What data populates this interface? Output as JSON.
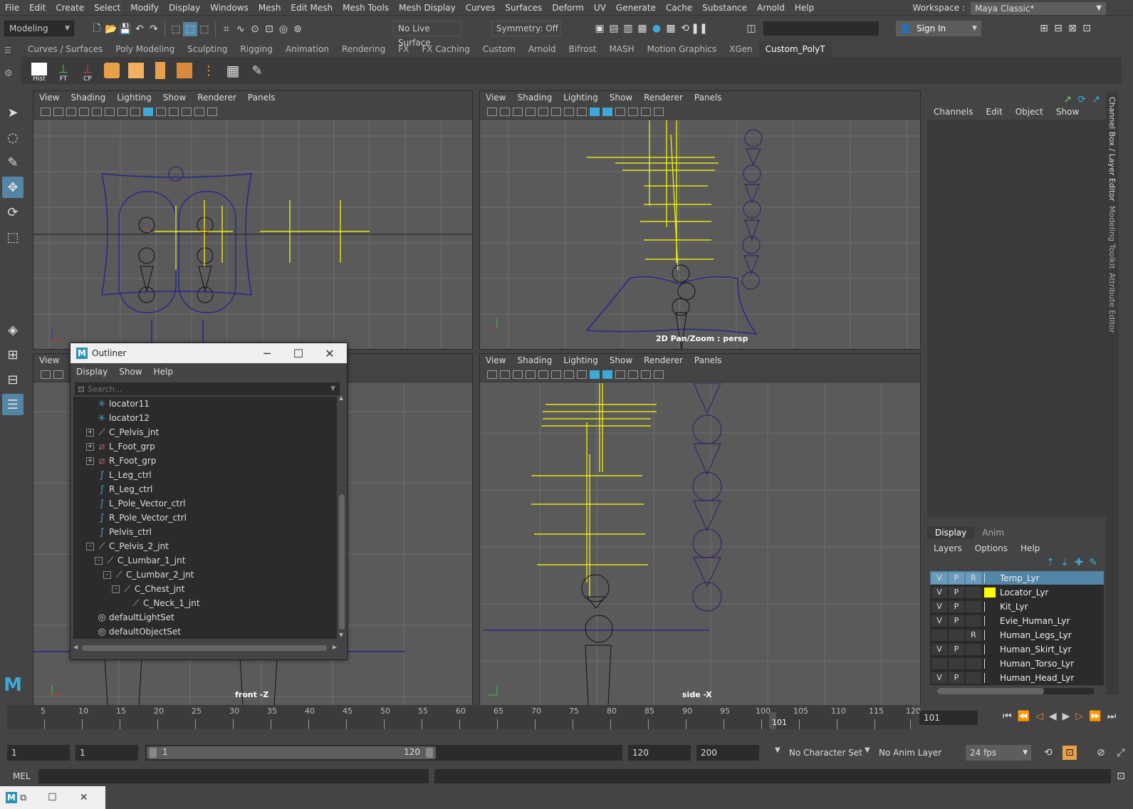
{
  "menubar": {
    "items": [
      "File",
      "Edit",
      "Create",
      "Select",
      "Modify",
      "Display",
      "Windows",
      "Mesh",
      "Edit Mesh",
      "Mesh Tools",
      "Mesh Display",
      "Curves",
      "Surfaces",
      "Deform",
      "UV",
      "Generate",
      "Cache",
      "Substance",
      "Arnold",
      "Help"
    ],
    "workspace_label": "Workspace :",
    "workspace_value": "Maya Classic*"
  },
  "statusline": {
    "mode": "Modeling",
    "live_surface": "No Live Surface",
    "symmetry": "Symmetry: Off",
    "sign_in": "Sign In"
  },
  "shelf": {
    "tabs": [
      "Curves / Surfaces",
      "Poly Modeling",
      "Sculpting",
      "Rigging",
      "Animation",
      "Rendering",
      "FX",
      "FX Caching",
      "Custom",
      "Arnold",
      "Bifrost",
      "MASH",
      "Motion Graphics",
      "XGen",
      "Custom_PolyT"
    ],
    "active_tab": "Custom_PolyT",
    "icon_labels": [
      "Hist",
      "FT",
      "CP"
    ]
  },
  "viewport_menu": [
    "View",
    "Shading",
    "Lighting",
    "Show",
    "Renderer",
    "Panels"
  ],
  "viewports": {
    "top_left_label": "",
    "top_right_label": "2D Pan/Zoom : persp",
    "bottom_left_label": "front -Z",
    "bottom_right_label": "side -X"
  },
  "channelbox": {
    "menu": [
      "Channels",
      "Edit",
      "Object",
      "Show"
    ],
    "side_tabs": [
      "Channel Box / Layer Editor",
      "Modeling Toolkit",
      "Attribute Editor"
    ]
  },
  "layers": {
    "tabs": [
      "Display",
      "Anim"
    ],
    "active_tab": "Display",
    "menu": [
      "Layers",
      "Options",
      "Help"
    ],
    "rows": [
      {
        "v": "V",
        "p": "P",
        "r": "R",
        "color": "",
        "name": "Temp_Lyr",
        "selected": true
      },
      {
        "v": "V",
        "p": "P",
        "r": "",
        "color": "#ffff00",
        "name": "Locator_Lyr",
        "selected": false
      },
      {
        "v": "V",
        "p": "P",
        "r": "",
        "color": "",
        "name": "Kit_Lyr",
        "selected": false
      },
      {
        "v": "V",
        "p": "P",
        "r": "",
        "color": "",
        "name": "Evie_Human_Lyr",
        "selected": false
      },
      {
        "v": "",
        "p": "",
        "r": "R",
        "color": "",
        "name": "Human_Legs_Lyr",
        "selected": false
      },
      {
        "v": "V",
        "p": "P",
        "r": "",
        "color": "",
        "name": "Human_Skirt_Lyr",
        "selected": false
      },
      {
        "v": "",
        "p": "",
        "r": "",
        "color": "",
        "name": "Human_Torso_Lyr",
        "selected": false
      },
      {
        "v": "V",
        "p": "P",
        "r": "",
        "color": "",
        "name": "Human_Head_Lyr",
        "selected": false
      }
    ]
  },
  "outliner": {
    "title": "Outliner",
    "menu": [
      "Display",
      "Show",
      "Help"
    ],
    "search_placeholder": "Search...",
    "items": [
      {
        "name": "locator11",
        "type": "locator",
        "depth": 0,
        "expander": ""
      },
      {
        "name": "locator12",
        "type": "locator",
        "depth": 0,
        "expander": ""
      },
      {
        "name": "C_Pelvis_jnt",
        "type": "joint",
        "depth": 0,
        "expander": "+"
      },
      {
        "name": "L_Foot_grp",
        "type": "group",
        "depth": 0,
        "expander": "+"
      },
      {
        "name": "R_Foot_grp",
        "type": "group",
        "depth": 0,
        "expander": "+"
      },
      {
        "name": "L_Leg_ctrl",
        "type": "curve",
        "depth": 0,
        "expander": ""
      },
      {
        "name": "R_Leg_ctrl",
        "type": "curve",
        "depth": 0,
        "expander": ""
      },
      {
        "name": "L_Pole_Vector_ctrl",
        "type": "curve",
        "depth": 0,
        "expander": ""
      },
      {
        "name": "R_Pole_Vector_ctrl",
        "type": "curve",
        "depth": 0,
        "expander": ""
      },
      {
        "name": "Pelvis_ctrl",
        "type": "curve",
        "depth": 0,
        "expander": ""
      },
      {
        "name": "C_Pelvis_2_jnt",
        "type": "joint",
        "depth": 0,
        "expander": "-"
      },
      {
        "name": "C_Lumbar_1_jnt",
        "type": "joint",
        "depth": 1,
        "expander": "-"
      },
      {
        "name": "C_Lumbar_2_jnt",
        "type": "joint",
        "depth": 2,
        "expander": "-"
      },
      {
        "name": "C_Chest_jnt",
        "type": "joint",
        "depth": 3,
        "expander": "-"
      },
      {
        "name": "C_Neck_1_jnt",
        "type": "joint",
        "depth": 4,
        "expander": ""
      },
      {
        "name": "defaultLightSet",
        "type": "set",
        "depth": 0,
        "expander": ""
      },
      {
        "name": "defaultObjectSet",
        "type": "set",
        "depth": 0,
        "expander": ""
      }
    ]
  },
  "timeline": {
    "ticks": [
      "5",
      "10",
      "15",
      "20",
      "25",
      "30",
      "35",
      "40",
      "45",
      "50",
      "55",
      "60",
      "65",
      "70",
      "75",
      "80",
      "85",
      "90",
      "95",
      "100",
      "105",
      "110",
      "115",
      "120"
    ],
    "current_frame_marker": "101",
    "current_frame": "101"
  },
  "range": {
    "start": "1",
    "playback_start": "1",
    "slider_start": "1",
    "slider_end": "120",
    "playback_end": "120",
    "end": "200",
    "character_set": "No Character Set",
    "anim_layer": "No Anim Layer",
    "fps": "24 fps"
  },
  "cmdline": {
    "label": "MEL"
  },
  "colors": {
    "accent": "#5285a6",
    "joint": "#b09ee6",
    "locator": "#ffff00",
    "curve": "#27278c"
  }
}
